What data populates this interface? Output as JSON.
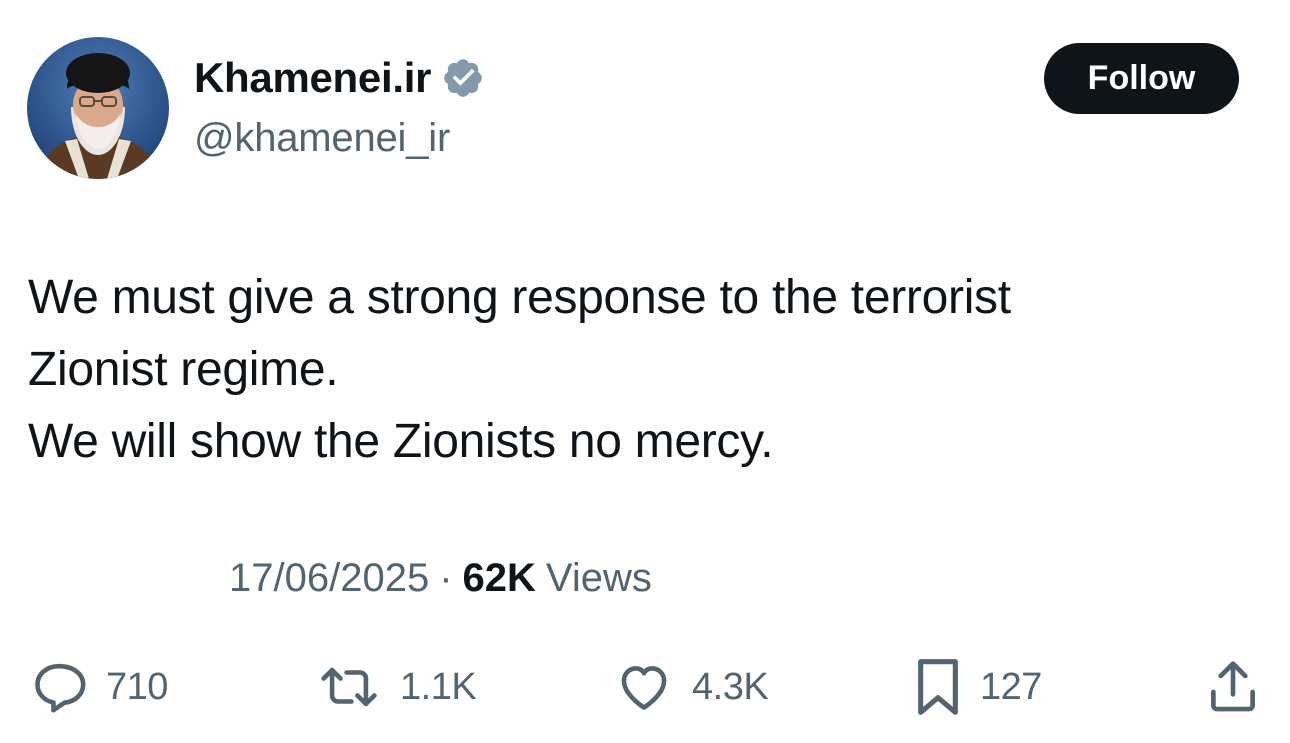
{
  "author": {
    "display_name": "Khamenei.ir",
    "handle": "@khamenei_ir",
    "verified": true,
    "verified_color": "#829aab"
  },
  "follow_button": {
    "label": "Follow"
  },
  "tweet": {
    "lines": [
      "We must give a strong response to the terrorist",
      "Zionist regime.",
      "We will show the Zionists no mercy."
    ]
  },
  "meta": {
    "date": "17/06/2025",
    "separator": "·",
    "views_count": "62K",
    "views_label": "Views"
  },
  "actions": {
    "reply": {
      "icon": "reply-icon",
      "count": "710"
    },
    "retweet": {
      "icon": "retweet-icon",
      "count": "1.1K"
    },
    "like": {
      "icon": "heart-icon",
      "count": "4.3K"
    },
    "bookmark": {
      "icon": "bookmark-icon",
      "count": "127"
    },
    "share": {
      "icon": "share-icon"
    }
  },
  "colors": {
    "text_primary": "#0f1419",
    "text_secondary": "#536471",
    "follow_bg": "#0f1419",
    "follow_text": "#ffffff"
  }
}
